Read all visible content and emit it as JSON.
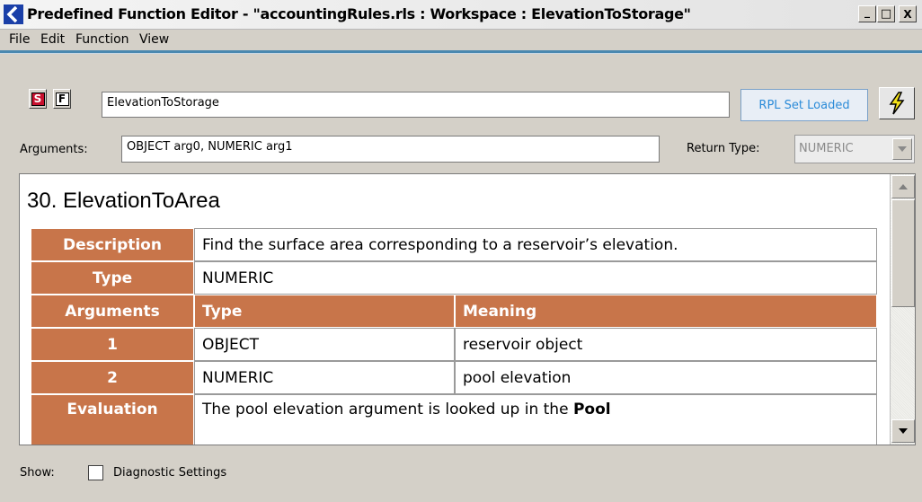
{
  "window": {
    "title": "Predefined Function Editor - \"accountingRules.rls : Workspace : ElevationToStorage\"",
    "minimize_glyph": "_",
    "maximize_glyph": "□",
    "close_glyph": "X"
  },
  "menu": [
    "File",
    "Edit",
    "Function",
    "View"
  ],
  "toolbar": {
    "s_button": "S",
    "f_button": "F",
    "function_name": "ElevationToStorage",
    "rpl_status": "RPL Set Loaded",
    "bolt_icon": "lightning-bolt-icon"
  },
  "signature": {
    "arguments_label": "Arguments:",
    "arguments_value": "OBJECT arg0, NUMERIC arg1",
    "return_type_label": "Return Type:",
    "return_type_value": "NUMERIC"
  },
  "doc": {
    "heading": "30.  ElevationToArea",
    "description_label": "Description",
    "description_value": "Find the surface area corresponding to a reservoir’s elevation.",
    "type_label": "Type",
    "type_value": "NUMERIC",
    "arguments_label": "Arguments",
    "arg_col_type": "Type",
    "arg_col_meaning": "Meaning",
    "args": [
      {
        "num": "1",
        "type": "OBJECT",
        "meaning": "reservoir object"
      },
      {
        "num": "2",
        "type": "NUMERIC",
        "meaning": "pool elevation"
      }
    ],
    "evaluation_label": "Evaluation",
    "evaluation_text": "The pool elevation argument is looked up in the",
    "evaluation_bold": "Pool"
  },
  "footer": {
    "show_label": "Show:",
    "diagnostic_label": "Diagnostic Settings",
    "diagnostic_checked": false
  },
  "colors": {
    "header_cell": "#c8754a",
    "rpl_text": "#2b8bd8",
    "accent_line": "#4a88b0",
    "s_button": "#c8102e"
  }
}
